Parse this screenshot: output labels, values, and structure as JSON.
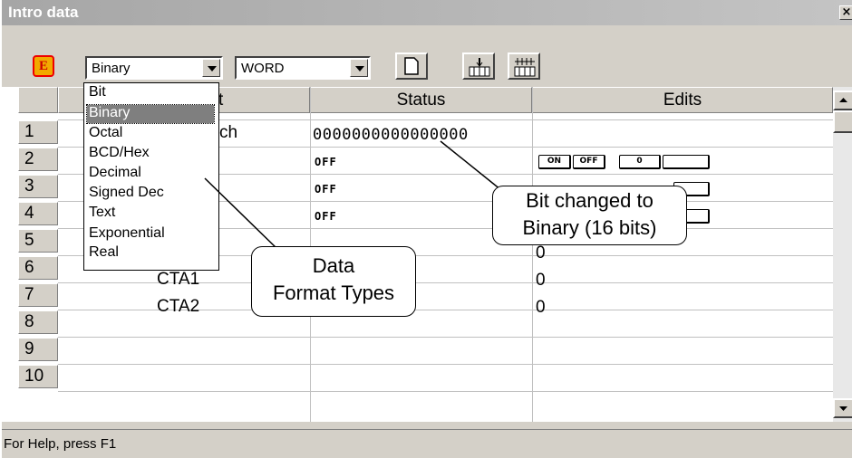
{
  "window": {
    "title": "Intro data",
    "close_label": "×"
  },
  "toolbar": {
    "e_icon_label": "E",
    "format_combo_value": "Binary",
    "size_combo_value": "WORD"
  },
  "columns": [
    "Element",
    "Status",
    "Edits"
  ],
  "column_partial": "t",
  "rows": [
    {
      "num": "1",
      "element": "ch",
      "status": "0000000000000000",
      "edit": ""
    },
    {
      "num": "2",
      "element": "",
      "status": "OFF",
      "edit": ""
    },
    {
      "num": "3",
      "element": "",
      "status": "OFF",
      "edit": ""
    },
    {
      "num": "4",
      "element": "",
      "status": "OFF",
      "edit": ""
    },
    {
      "num": "5",
      "element": "",
      "status": "",
      "edit": "0"
    },
    {
      "num": "6",
      "element": "CTA1",
      "status": "",
      "edit": "0"
    },
    {
      "num": "7",
      "element": "CTA2",
      "status": "",
      "edit": "0"
    },
    {
      "num": "8",
      "element": "",
      "status": "",
      "edit": ""
    },
    {
      "num": "9",
      "element": "",
      "status": "",
      "edit": ""
    },
    {
      "num": "10",
      "element": "",
      "status": "",
      "edit": ""
    }
  ],
  "edit_buttons": {
    "on": "ON",
    "off": "OFF",
    "zero": "0"
  },
  "dropdown": {
    "items": [
      "Bit",
      "Binary",
      "Octal",
      "BCD/Hex",
      "Decimal",
      "Signed Dec",
      "Text",
      "Exponential",
      "Real"
    ],
    "selected": "Binary"
  },
  "callouts": {
    "format_types_line1": "Data",
    "format_types_line2": "Format Types",
    "bit_changed_line1": "Bit changed to",
    "bit_changed_line2": "Binary (16 bits)"
  },
  "statusbar": {
    "text": "For Help, press F1"
  }
}
